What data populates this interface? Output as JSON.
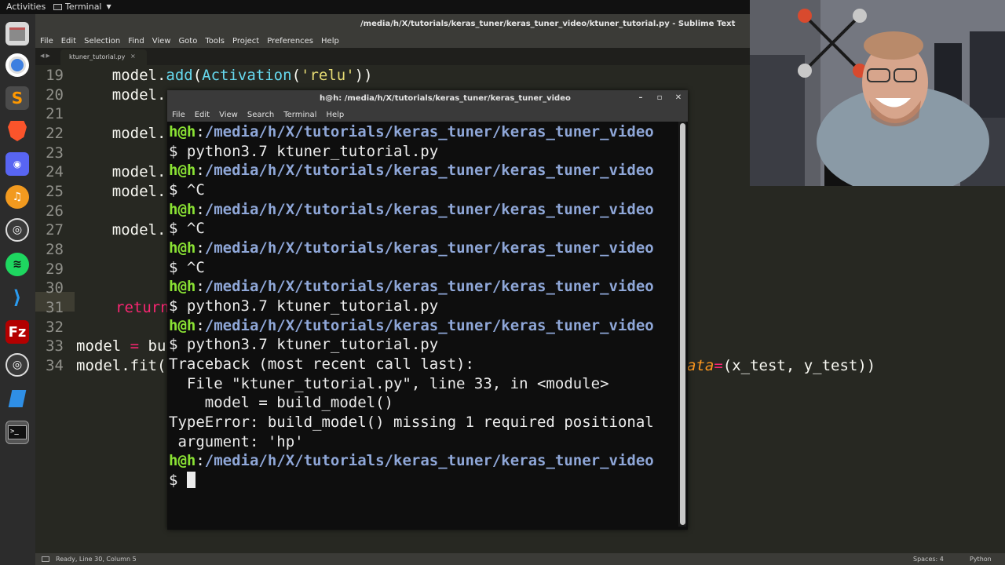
{
  "topbar": {
    "activities": "Activities",
    "app_name": "Terminal"
  },
  "dock": {
    "items": [
      "file-manager-icon",
      "chromium-icon",
      "sublime-text-icon",
      "brave-icon",
      "discord-icon",
      "rhythmbox-icon",
      "obs-icon",
      "spotify-icon",
      "vscode-icon",
      "filezilla-icon",
      "obs-icon-2",
      "app-icon",
      "terminal-icon"
    ]
  },
  "sublime": {
    "title": "/media/h/X/tutorials/keras_tuner/keras_tuner_video/ktuner_tutorial.py - Sublime Text",
    "menu": [
      "File",
      "Edit",
      "Selection",
      "Find",
      "View",
      "Goto",
      "Tools",
      "Project",
      "Preferences",
      "Help"
    ],
    "tab_name": "ktuner_tutorial.py",
    "tab_close": "×",
    "line_numbers": [
      "19",
      "20",
      "21",
      "22",
      "23",
      "24",
      "25",
      "26",
      "27",
      "28",
      "29",
      "30",
      "31",
      "32",
      "33",
      "34"
    ],
    "code": {
      "l19_a": "    model.",
      "l19_b": "add",
      "l19_c": "(",
      "l19_d": "Activation",
      "l19_e": "(",
      "l19_f": "'relu'",
      "l19_g": "))",
      "l20": "    model.",
      "l22": "    model.",
      "l24": "    model.",
      "l25": "    model.",
      "l27": "    model.",
      "l31": "return",
      "l33_a": "model ",
      "l33_b": "=",
      "l33_c": " bu",
      "l34": "model.fit(",
      "l34_right_a": "ata",
      "l34_right_b": "=",
      "l34_right_c": "(x_test, y_test))"
    },
    "status": "Line 30, Column 5",
    "status_prefix": "Ready, ",
    "status_spaces": "Spaces: 4",
    "status_lang": "Python"
  },
  "terminal": {
    "title": "h@h: /media/h/X/tutorials/keras_tuner/keras_tuner_video",
    "menu": [
      "File",
      "Edit",
      "View",
      "Search",
      "Terminal",
      "Help"
    ],
    "user": "h@h",
    "colon": ":",
    "path": "/media/h/X/tutorials/keras_tuner/keras_tuner_video",
    "lines": {
      "cmd1": "$ python3.7 ktuner_tutorial.py",
      "ctrl_c": "$ ^C",
      "tb0": "Traceback (most recent call last):",
      "tb1": "  File \"ktuner_tutorial.py\", line 33, in <module>",
      "tb2": "    model = build_model()",
      "tb3": "TypeError: build_model() missing 1 required positional",
      "tb4": " argument: 'hp'",
      "prompt": "$ ",
      "inline_cmd": "$ python3.7 ktuner_tutorial.py"
    }
  }
}
